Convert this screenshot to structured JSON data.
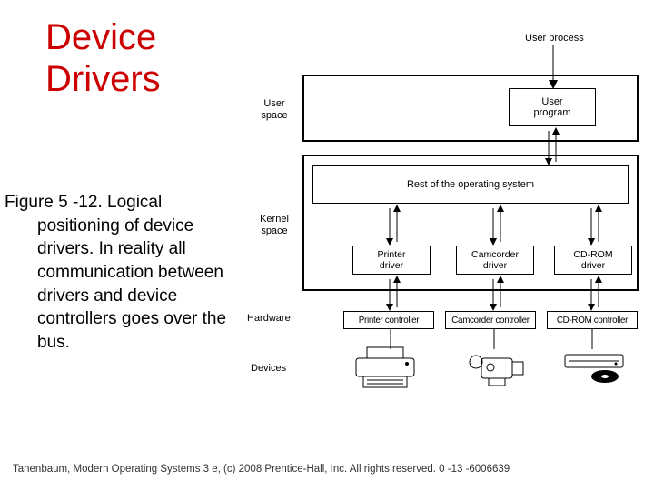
{
  "title_line1": "Device",
  "title_line2": "Drivers",
  "caption_first": "Figure 5 -12. Logical",
  "caption_rest": "positioning of device drivers. In reality all communication between drivers and device controllers goes over the bus.",
  "footer": "Tanenbaum, Modern Operating Systems 3 e, (c) 2008 Prentice-Hall, Inc. All rights reserved. 0 -13 -6006639",
  "diagram": {
    "user_process": "User process",
    "user_program": "User\nprogram",
    "user_space": "User\nspace",
    "kernel_space": "Kernel\nspace",
    "rest_os": "Rest of the operating system",
    "drivers": [
      "Printer\ndriver",
      "Camcorder\ndriver",
      "CD-ROM\ndriver"
    ],
    "hardware": "Hardware",
    "controllers": [
      "Printer controller",
      "Camcorder controller",
      "CD-ROM controller"
    ],
    "devices_label": "Devices"
  }
}
